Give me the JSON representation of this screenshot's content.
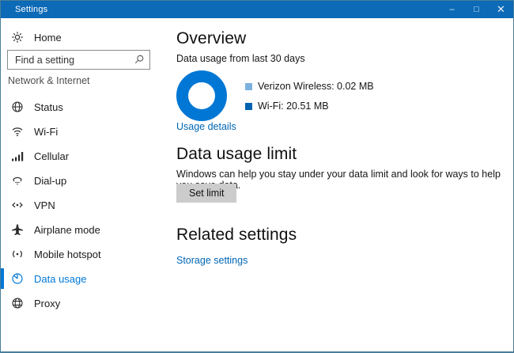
{
  "window": {
    "title": "Settings",
    "controls": {
      "minimize": "–",
      "maximize": "□",
      "close": "✕"
    }
  },
  "sidebar": {
    "home_label": "Home",
    "search_placeholder": "Find a setting",
    "section_label": "Network & Internet",
    "items": [
      {
        "label": "Status",
        "icon": "globe-icon",
        "selected": false
      },
      {
        "label": "Wi-Fi",
        "icon": "wifi-icon",
        "selected": false
      },
      {
        "label": "Cellular",
        "icon": "cellular-signal-icon",
        "selected": false
      },
      {
        "label": "Dial-up",
        "icon": "dialup-phone-icon",
        "selected": false
      },
      {
        "label": "VPN",
        "icon": "vpn-icon",
        "selected": false
      },
      {
        "label": "Airplane mode",
        "icon": "airplane-icon",
        "selected": false
      },
      {
        "label": "Mobile hotspot",
        "icon": "hotspot-icon",
        "selected": false
      },
      {
        "label": "Data usage",
        "icon": "pie-chart-icon",
        "selected": true
      },
      {
        "label": "Proxy",
        "icon": "proxy-globe-icon",
        "selected": false
      }
    ]
  },
  "main": {
    "overview_heading": "Overview",
    "subtitle": "Data usage from last 30 days",
    "usage_details_link": "Usage details",
    "limit_heading": "Data usage limit",
    "limit_description": "Windows can help you stay under your data limit and look for ways to help you save data.",
    "set_limit_button": "Set limit",
    "related_heading": "Related settings",
    "storage_link": "Storage settings"
  },
  "chart_data": {
    "type": "pie",
    "subtype": "donut",
    "title": "Data usage from last 30 days",
    "categories": [
      "Verizon Wireless",
      "Wi-Fi"
    ],
    "values": [
      0.02,
      20.51
    ],
    "unit": "MB",
    "legend_position": "right",
    "legend": [
      {
        "label": "Verizon Wireless: 0.02 MB",
        "color": "#7db2e0"
      },
      {
        "label": "Wi-Fi: 20.51 MB",
        "color": "#0063b1"
      }
    ],
    "donut_color": "#0077d4"
  },
  "colors": {
    "titlebar": "#0c6ab6",
    "accent": "#0078d7",
    "link": "#0066b4",
    "button_bg": "#cccccc",
    "window_border": "#4a7e9b"
  }
}
